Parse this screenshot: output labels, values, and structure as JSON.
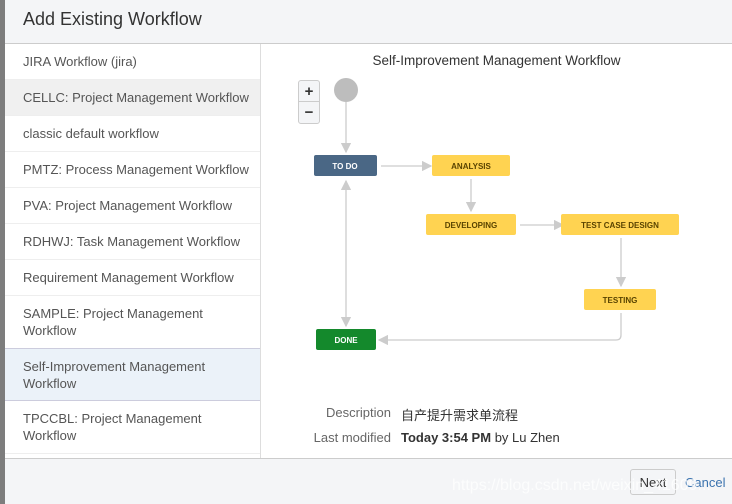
{
  "dialog": {
    "title": "Add Existing Workflow"
  },
  "workflows": [
    {
      "label": "JIRA Workflow (jira)"
    },
    {
      "label": "CELLC: Project Management Workflow"
    },
    {
      "label": "classic default workflow"
    },
    {
      "label": "PMTZ: Process Management Workflow"
    },
    {
      "label": "PVA: Project Management Workflow"
    },
    {
      "label": "RDHWJ: Task Management Workflow"
    },
    {
      "label": "Requirement Management Workflow"
    },
    {
      "label": "SAMPLE: Project Management Workflow"
    },
    {
      "label": "Self-Improvement Management Workflow",
      "selected": true
    },
    {
      "label": "TPCCBL: Project Management Workflow"
    }
  ],
  "preview": {
    "title": "Self-Improvement Management Workflow",
    "zoom_in": "+",
    "zoom_out": "−",
    "statuses": {
      "todo": "TO DO",
      "analysis": "ANALYSIS",
      "developing": "DEVELOPING",
      "test_case_design": "TEST CASE DESIGN",
      "testing": "TESTING",
      "done": "DONE"
    },
    "colors": {
      "todo": "#4a6785",
      "inprogress": "#ffd351",
      "done": "#14892c"
    },
    "description_label": "Description",
    "description": "自产提升需求单流程",
    "modified_label": "Last modified",
    "modified_time": "Today 3:54 PM",
    "modified_by": "by Lu Zhen"
  },
  "footer": {
    "next": "Next",
    "cancel": "Cancel",
    "watermark": "https://blog.csdn.net/weixin_41609..."
  }
}
